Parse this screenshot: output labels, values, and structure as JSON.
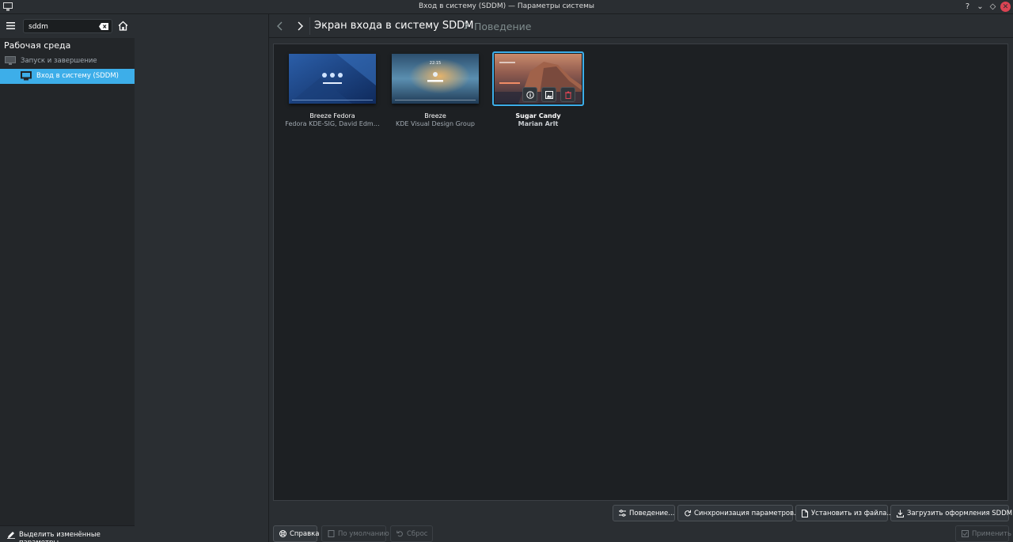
{
  "window": {
    "title": "Вход в систему (SDDM) — Параметры системы",
    "buttons": {
      "help": "?",
      "minimize": "⌄",
      "maximize": "◇",
      "close": "✕"
    }
  },
  "sidebar": {
    "search_value": "sddm",
    "category": "Рабочая среда",
    "group": "Запуск и завершение",
    "selected_item": "Вход в систему (SDDM)",
    "highlight_changed": "Выделить изменённые параметры"
  },
  "breadcrumb": {
    "main": "Экран входа в систему SDDM",
    "sub": "Поведение"
  },
  "themes": [
    {
      "name": "Breeze Fedora",
      "author": "Fedora KDE-SIG, David Edm…",
      "selected": false
    },
    {
      "name": "Breeze",
      "author": "KDE Visual Design Group",
      "selected": false
    },
    {
      "name": "Sugar Candy",
      "author": "Marian Arlt",
      "selected": true
    }
  ],
  "actions": {
    "behavior": "Поведение...",
    "sync": "Синхронизация параметров...",
    "install": "Установить из файла...",
    "download": "Загрузить оформления SDDM..."
  },
  "footer": {
    "help": "Справка",
    "defaults": "По умолчанию",
    "reset": "Сброс",
    "apply": "Применить"
  },
  "colors": {
    "accent": "#3daee9",
    "window_bg": "#2a2e32",
    "view_bg": "#1d2023",
    "close": "#da4453"
  },
  "icons": [
    "app-icon",
    "hamburger-menu-icon",
    "clear-text-icon",
    "home-icon",
    "monitor-icon",
    "back-icon",
    "forward-icon",
    "chevron-right-icon",
    "info-icon",
    "wallpaper-icon",
    "trash-icon",
    "settings-icon",
    "sync-icon",
    "file-icon",
    "download-icon",
    "help-icon",
    "undo-icon",
    "check-icon",
    "pencil-icon"
  ]
}
